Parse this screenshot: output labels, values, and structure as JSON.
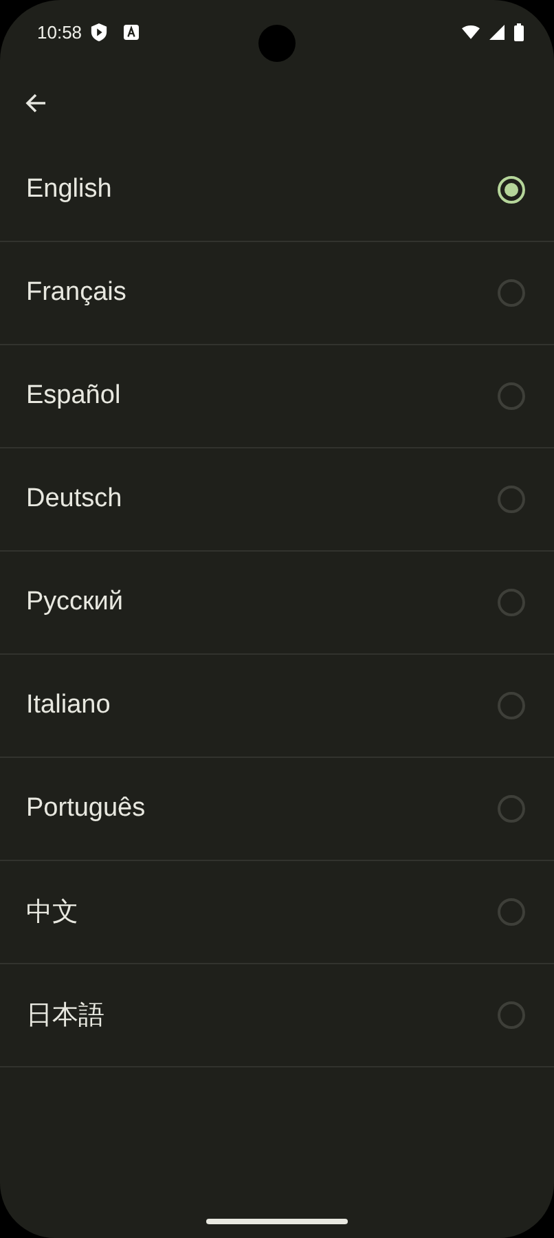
{
  "status_bar": {
    "time": "10:58"
  },
  "languages": [
    {
      "label": "English",
      "selected": true
    },
    {
      "label": "Français",
      "selected": false
    },
    {
      "label": "Español",
      "selected": false
    },
    {
      "label": "Deutsch",
      "selected": false
    },
    {
      "label": "Русский",
      "selected": false
    },
    {
      "label": "Italiano",
      "selected": false
    },
    {
      "label": "Português",
      "selected": false
    },
    {
      "label": "中文",
      "selected": false
    },
    {
      "label": "日本語",
      "selected": false
    }
  ]
}
